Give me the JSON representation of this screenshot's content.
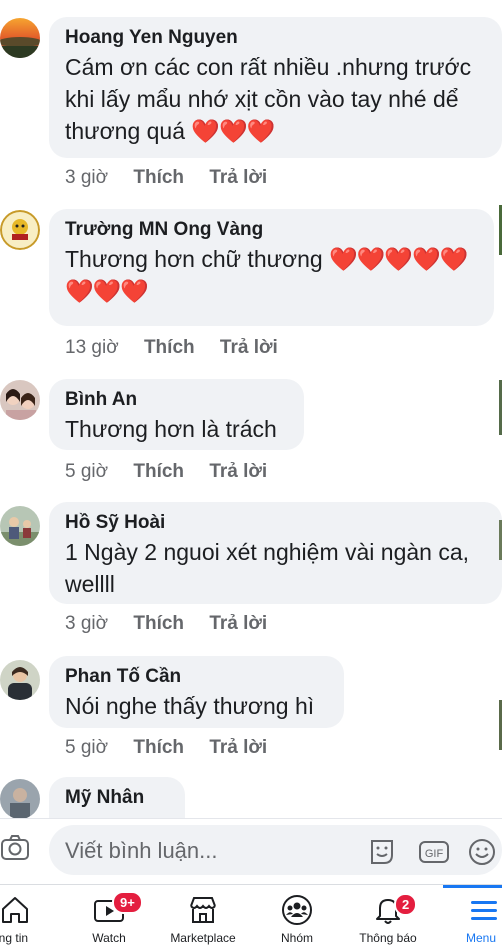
{
  "comments": [
    {
      "author": "Hoang Yen Nguyen",
      "lines": [
        "Cám ơn các con rất nhiều .nhưng trước",
        "khi lấy mẩu nhớ xịt cồn vào tay nhé dể",
        "thương quá"
      ],
      "hearts": "❤️❤️❤️",
      "time": "3 giờ",
      "like": "Thích",
      "reply": "Trả lời"
    },
    {
      "author": "Trường MN Ong Vàng",
      "lines": [
        "Thương hơn chữ thương"
      ],
      "hearts": "❤️❤️❤️❤️❤️",
      "hearts2": "❤️❤️❤️",
      "time": "13 giờ",
      "like": "Thích",
      "reply": "Trả lời"
    },
    {
      "author": "Bình An",
      "lines": [
        "Thương hơn là trách"
      ],
      "time": "5 giờ",
      "like": "Thích",
      "reply": "Trả lời"
    },
    {
      "author": "Hồ Sỹ Hoài",
      "lines": [
        "1 Ngày  2 nguoi xét nghiệm vài ngàn ca,",
        "wellll"
      ],
      "time": "3 giờ",
      "like": "Thích",
      "reply": "Trả lời"
    },
    {
      "author": "Phan Tố Cần",
      "lines": [
        "Nói nghe thấy thương hì"
      ],
      "time": "5 giờ",
      "like": "Thích",
      "reply": "Trả lời"
    },
    {
      "author": "Mỹ Nhân"
    }
  ],
  "composer": {
    "placeholder": "Viết bình luận...",
    "icons": [
      "camera-icon",
      "sticker-icon",
      "gif-icon",
      "emoji-icon"
    ],
    "gif_label": "GIF"
  },
  "tabbar": {
    "tabs": [
      {
        "label": "ảng tin",
        "icon": "home-icon"
      },
      {
        "label": "Watch",
        "icon": "watch-icon",
        "badge": "9+"
      },
      {
        "label": "Marketplace",
        "icon": "marketplace-icon"
      },
      {
        "label": "Nhóm",
        "icon": "groups-icon"
      },
      {
        "label": "Thông báo",
        "icon": "bell-icon",
        "badge": "2"
      },
      {
        "label": "Menu",
        "icon": "menu-icon",
        "active": true
      }
    ]
  },
  "colors": {
    "accent": "#1877f2",
    "badge": "#e41e3f",
    "bubble": "#f0f2f5",
    "meta": "#65676b"
  }
}
